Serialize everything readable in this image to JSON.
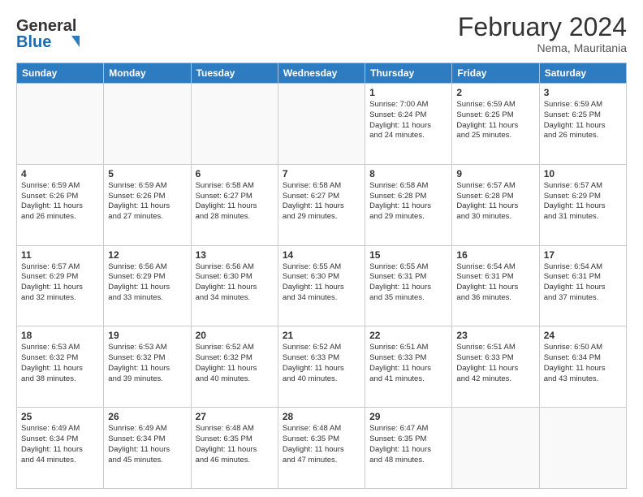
{
  "header": {
    "logo_line1": "General",
    "logo_line2": "Blue",
    "month_title": "February 2024",
    "location": "Nema, Mauritania"
  },
  "weekdays": [
    "Sunday",
    "Monday",
    "Tuesday",
    "Wednesday",
    "Thursday",
    "Friday",
    "Saturday"
  ],
  "weeks": [
    [
      {
        "day": "",
        "info": ""
      },
      {
        "day": "",
        "info": ""
      },
      {
        "day": "",
        "info": ""
      },
      {
        "day": "",
        "info": ""
      },
      {
        "day": "1",
        "info": "Sunrise: 7:00 AM\nSunset: 6:24 PM\nDaylight: 11 hours\nand 24 minutes."
      },
      {
        "day": "2",
        "info": "Sunrise: 6:59 AM\nSunset: 6:25 PM\nDaylight: 11 hours\nand 25 minutes."
      },
      {
        "day": "3",
        "info": "Sunrise: 6:59 AM\nSunset: 6:25 PM\nDaylight: 11 hours\nand 26 minutes."
      }
    ],
    [
      {
        "day": "4",
        "info": "Sunrise: 6:59 AM\nSunset: 6:26 PM\nDaylight: 11 hours\nand 26 minutes."
      },
      {
        "day": "5",
        "info": "Sunrise: 6:59 AM\nSunset: 6:26 PM\nDaylight: 11 hours\nand 27 minutes."
      },
      {
        "day": "6",
        "info": "Sunrise: 6:58 AM\nSunset: 6:27 PM\nDaylight: 11 hours\nand 28 minutes."
      },
      {
        "day": "7",
        "info": "Sunrise: 6:58 AM\nSunset: 6:27 PM\nDaylight: 11 hours\nand 29 minutes."
      },
      {
        "day": "8",
        "info": "Sunrise: 6:58 AM\nSunset: 6:28 PM\nDaylight: 11 hours\nand 29 minutes."
      },
      {
        "day": "9",
        "info": "Sunrise: 6:57 AM\nSunset: 6:28 PM\nDaylight: 11 hours\nand 30 minutes."
      },
      {
        "day": "10",
        "info": "Sunrise: 6:57 AM\nSunset: 6:29 PM\nDaylight: 11 hours\nand 31 minutes."
      }
    ],
    [
      {
        "day": "11",
        "info": "Sunrise: 6:57 AM\nSunset: 6:29 PM\nDaylight: 11 hours\nand 32 minutes."
      },
      {
        "day": "12",
        "info": "Sunrise: 6:56 AM\nSunset: 6:29 PM\nDaylight: 11 hours\nand 33 minutes."
      },
      {
        "day": "13",
        "info": "Sunrise: 6:56 AM\nSunset: 6:30 PM\nDaylight: 11 hours\nand 34 minutes."
      },
      {
        "day": "14",
        "info": "Sunrise: 6:55 AM\nSunset: 6:30 PM\nDaylight: 11 hours\nand 34 minutes."
      },
      {
        "day": "15",
        "info": "Sunrise: 6:55 AM\nSunset: 6:31 PM\nDaylight: 11 hours\nand 35 minutes."
      },
      {
        "day": "16",
        "info": "Sunrise: 6:54 AM\nSunset: 6:31 PM\nDaylight: 11 hours\nand 36 minutes."
      },
      {
        "day": "17",
        "info": "Sunrise: 6:54 AM\nSunset: 6:31 PM\nDaylight: 11 hours\nand 37 minutes."
      }
    ],
    [
      {
        "day": "18",
        "info": "Sunrise: 6:53 AM\nSunset: 6:32 PM\nDaylight: 11 hours\nand 38 minutes."
      },
      {
        "day": "19",
        "info": "Sunrise: 6:53 AM\nSunset: 6:32 PM\nDaylight: 11 hours\nand 39 minutes."
      },
      {
        "day": "20",
        "info": "Sunrise: 6:52 AM\nSunset: 6:32 PM\nDaylight: 11 hours\nand 40 minutes."
      },
      {
        "day": "21",
        "info": "Sunrise: 6:52 AM\nSunset: 6:33 PM\nDaylight: 11 hours\nand 40 minutes."
      },
      {
        "day": "22",
        "info": "Sunrise: 6:51 AM\nSunset: 6:33 PM\nDaylight: 11 hours\nand 41 minutes."
      },
      {
        "day": "23",
        "info": "Sunrise: 6:51 AM\nSunset: 6:33 PM\nDaylight: 11 hours\nand 42 minutes."
      },
      {
        "day": "24",
        "info": "Sunrise: 6:50 AM\nSunset: 6:34 PM\nDaylight: 11 hours\nand 43 minutes."
      }
    ],
    [
      {
        "day": "25",
        "info": "Sunrise: 6:49 AM\nSunset: 6:34 PM\nDaylight: 11 hours\nand 44 minutes."
      },
      {
        "day": "26",
        "info": "Sunrise: 6:49 AM\nSunset: 6:34 PM\nDaylight: 11 hours\nand 45 minutes."
      },
      {
        "day": "27",
        "info": "Sunrise: 6:48 AM\nSunset: 6:35 PM\nDaylight: 11 hours\nand 46 minutes."
      },
      {
        "day": "28",
        "info": "Sunrise: 6:48 AM\nSunset: 6:35 PM\nDaylight: 11 hours\nand 47 minutes."
      },
      {
        "day": "29",
        "info": "Sunrise: 6:47 AM\nSunset: 6:35 PM\nDaylight: 11 hours\nand 48 minutes."
      },
      {
        "day": "",
        "info": ""
      },
      {
        "day": "",
        "info": ""
      }
    ]
  ]
}
